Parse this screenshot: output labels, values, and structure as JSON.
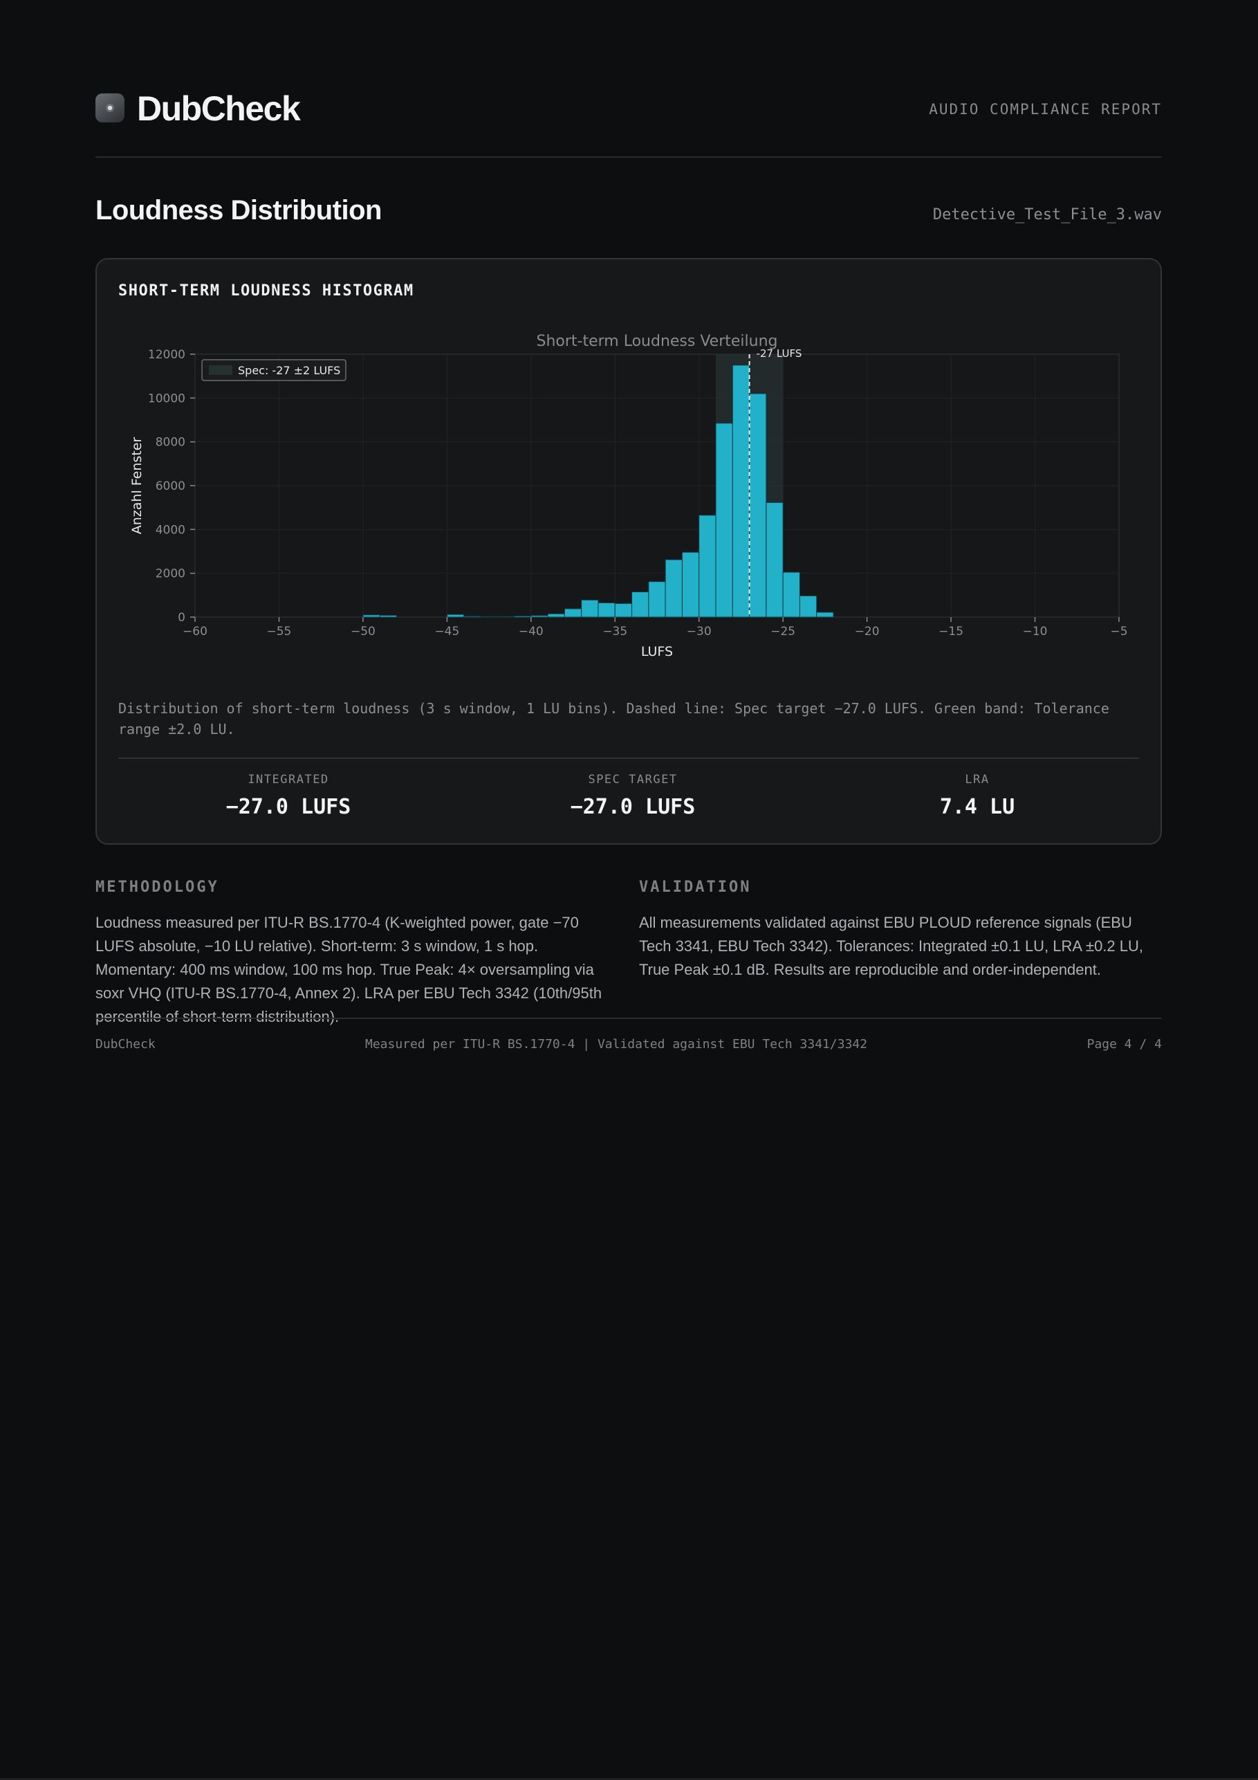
{
  "header": {
    "brand": "DubCheck",
    "report_label": "AUDIO COMPLIANCE REPORT"
  },
  "section": {
    "title": "Loudness Distribution",
    "filename": "Detective_Test_File_3.wav"
  },
  "card": {
    "title": "SHORT-TERM LOUDNESS HISTOGRAM",
    "caption": "Distribution of short-term loudness (3 s window, 1 LU bins). Dashed line: Spec target −27.0 LUFS. Green band: Tolerance range ±2.0 LU."
  },
  "chart_data": {
    "type": "bar",
    "title": "Short-term Loudness Verteilung",
    "xlabel": "LUFS",
    "ylabel": "Anzahl Fenster",
    "xlim": [
      -60,
      -5
    ],
    "ylim": [
      0,
      12000
    ],
    "xticks": [
      -60,
      -55,
      -50,
      -45,
      -40,
      -35,
      -30,
      -25,
      -20,
      -15,
      -10,
      -5
    ],
    "yticks": [
      0,
      2000,
      4000,
      6000,
      8000,
      10000,
      12000
    ],
    "bin_width": 1,
    "bins": [
      {
        "x0": -50,
        "value": 100
      },
      {
        "x0": -49,
        "value": 80
      },
      {
        "x0": -45,
        "value": 120
      },
      {
        "x0": -44,
        "value": 40
      },
      {
        "x0": -43,
        "value": 30
      },
      {
        "x0": -42,
        "value": 30
      },
      {
        "x0": -41,
        "value": 50
      },
      {
        "x0": -40,
        "value": 70
      },
      {
        "x0": -39,
        "value": 150
      },
      {
        "x0": -38,
        "value": 380
      },
      {
        "x0": -37,
        "value": 780
      },
      {
        "x0": -36,
        "value": 650
      },
      {
        "x0": -35,
        "value": 620
      },
      {
        "x0": -34,
        "value": 1150
      },
      {
        "x0": -33,
        "value": 1620
      },
      {
        "x0": -32,
        "value": 2620
      },
      {
        "x0": -31,
        "value": 2960
      },
      {
        "x0": -30,
        "value": 4650
      },
      {
        "x0": -29,
        "value": 8850
      },
      {
        "x0": -28,
        "value": 11500
      },
      {
        "x0": -27,
        "value": 10200
      },
      {
        "x0": -26,
        "value": 5230
      },
      {
        "x0": -25,
        "value": 2050
      },
      {
        "x0": -24,
        "value": 970
      },
      {
        "x0": -23,
        "value": 220
      }
    ],
    "target": -27,
    "target_label": "-27 LUFS",
    "band": [
      -29,
      -25
    ],
    "legend": {
      "label": "Spec: -27 ±2 LUFS",
      "position": "top-left"
    },
    "grid": true,
    "bar_color": "#22b1c9"
  },
  "stats": [
    {
      "label": "INTEGRATED",
      "value": "−27.0 LUFS"
    },
    {
      "label": "SPEC TARGET",
      "value": "−27.0 LUFS"
    },
    {
      "label": "LRA",
      "value": "7.4 LU"
    }
  ],
  "methodology": {
    "title": "METHODOLOGY",
    "text": "Loudness measured per ITU-R BS.1770-4 (K-weighted power, gate −70 LUFS absolute, −10 LU relative). Short-term: 3 s window, 1 s hop. Momentary: 400 ms window, 100 ms hop. True Peak: 4× oversampling via soxr VHQ (ITU-R BS.1770-4, Annex 2). LRA per EBU Tech 3342 (10th/95th percentile of short-term distribution)."
  },
  "validation": {
    "title": "VALIDATION",
    "text": "All measurements validated against EBU PLOUD reference signals (EBU Tech 3341, EBU Tech 3342). Tolerances: Integrated ±0.1 LU, LRA ±0.2 LU, True Peak ±0.1 dB. Results are reproducible and order-independent."
  },
  "footer": {
    "left": "DubCheck",
    "center": "Measured per ITU-R BS.1770-4 | Validated against EBU Tech 3341/3342",
    "right": "Page 4 / 4"
  }
}
